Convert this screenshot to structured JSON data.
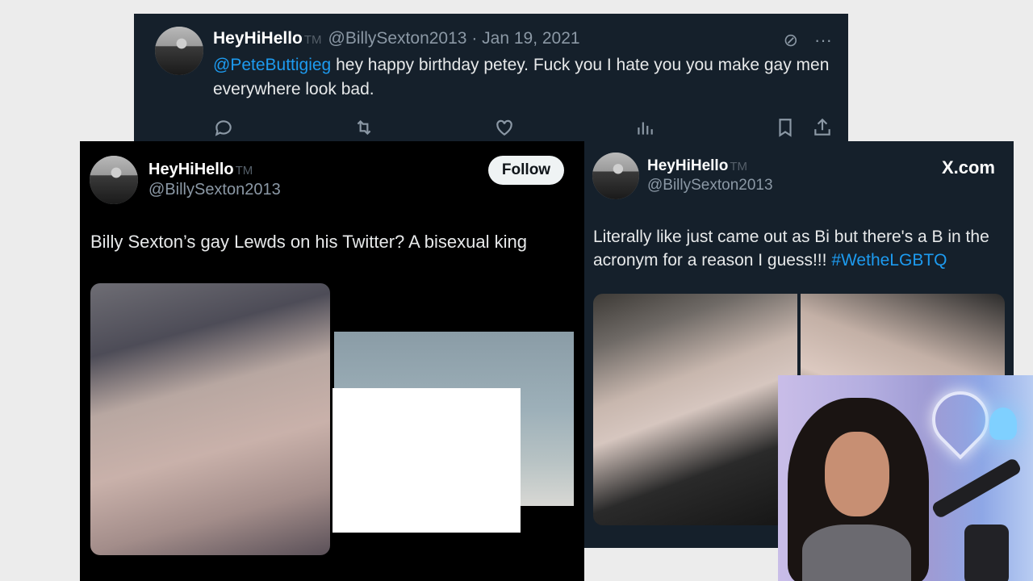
{
  "top_tweet": {
    "name": "HeyHiHello",
    "tm": "TM",
    "handle": "@BillySexton2013",
    "separator": "·",
    "date": "Jan 19, 2021",
    "mention": "@PeteButtigieg",
    "text": " hey happy birthday petey. Fuck you I hate you you make gay men everywhere look bad.",
    "icons": [
      "grok-slash-icon",
      "more-icon"
    ],
    "actions": [
      "reply-icon",
      "retweet-icon",
      "like-icon",
      "views-icon",
      "bookmark-icon",
      "share-icon"
    ]
  },
  "left_tweet": {
    "name": "HeyHiHello",
    "tm": "TM",
    "handle": "@BillySexton2013",
    "follow_label": "Follow",
    "text": "Billy Sexton’s gay Lewds on his Twitter? A bisexual king"
  },
  "right_tweet": {
    "name": "HeyHiHello",
    "tm": "TM",
    "handle": "@BillySexton2013",
    "source": "X.com",
    "text": "Literally like just came out as Bi but there's a B in the acronym for a reason I guess!!! ",
    "hashtag": "#WetheLGBTQ"
  },
  "colors": {
    "dim_bg": "#15202b",
    "black_bg": "#000000",
    "link": "#1d9bf0",
    "muted": "#8b98a5"
  }
}
